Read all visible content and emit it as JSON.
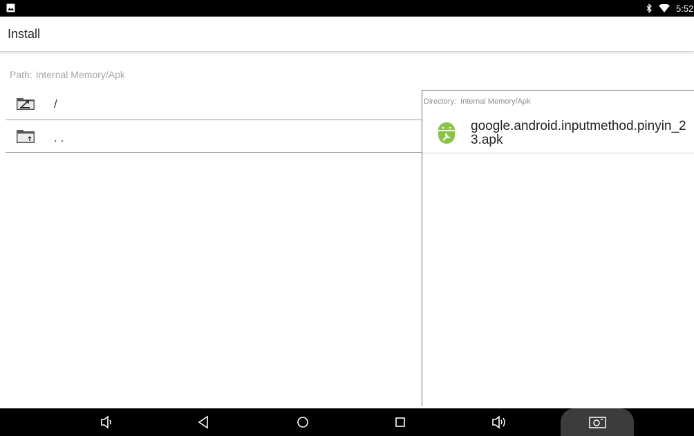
{
  "status_bar": {
    "time": "5:52"
  },
  "toolbar": {
    "title": "Install"
  },
  "path": {
    "label": "Path:",
    "value": "Internal Memory/Apk"
  },
  "directories": [
    {
      "name": "/"
    },
    {
      "name": ". ."
    }
  ],
  "directory_panel": {
    "label": "Directory:",
    "value": "Internal Memory/Apk",
    "files": [
      {
        "name": "google.android.inputmethod.pinyin_23.apk"
      }
    ]
  },
  "colors": {
    "android_green": "#8bc34a",
    "status_bar_bg": "#000000"
  },
  "icons": [
    "notification-image-icon",
    "bluetooth-icon",
    "wifi-icon",
    "folder-up-icon",
    "folder-icon",
    "android-apk-icon",
    "volume-down-icon",
    "back-icon",
    "home-icon",
    "recents-icon",
    "volume-up-icon",
    "screenshot-icon"
  ]
}
